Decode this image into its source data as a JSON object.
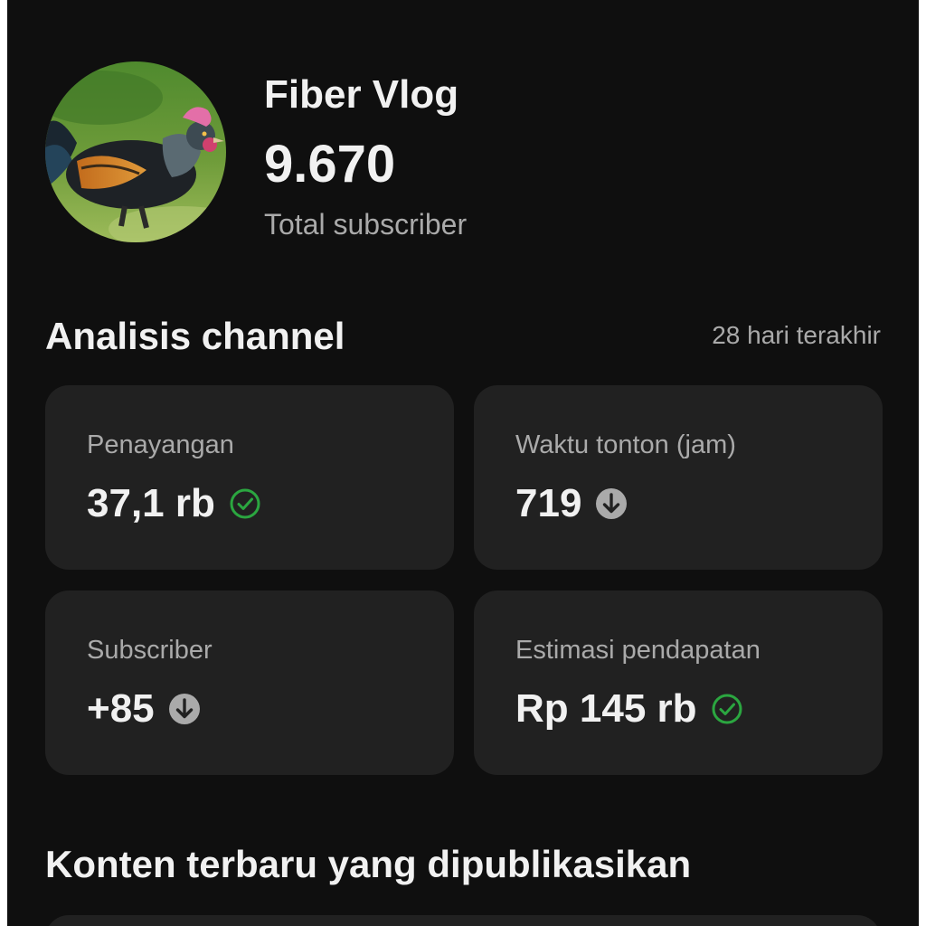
{
  "channel": {
    "name": "Fiber Vlog",
    "subscriber_count": "9.670",
    "subscriber_caption": "Total subscriber",
    "avatar_icon": "rooster-avatar"
  },
  "analytics": {
    "title": "Analisis channel",
    "period": "28 hari terakhir",
    "cards": [
      {
        "label": "Penayangan",
        "value": "37,1 rb",
        "status": "check-circle-icon",
        "status_color": "#2ba640"
      },
      {
        "label": "Waktu tonton (jam)",
        "value": "719",
        "status": "arrow-down-circle-icon",
        "status_color": "#aaaaaa"
      },
      {
        "label": "Subscriber",
        "value": "+85",
        "status": "arrow-down-circle-icon",
        "status_color": "#aaaaaa"
      },
      {
        "label": "Estimasi pendapatan",
        "value": "Rp 145 rb",
        "status": "check-circle-icon",
        "status_color": "#2ba640"
      }
    ]
  },
  "recent": {
    "title": "Konten terbaru yang dipublikasikan"
  },
  "colors": {
    "background": "#0f0f0f",
    "card": "#212121",
    "text_primary": "#f1f1f1",
    "text_secondary": "#aaaaaa",
    "positive": "#2ba640"
  }
}
